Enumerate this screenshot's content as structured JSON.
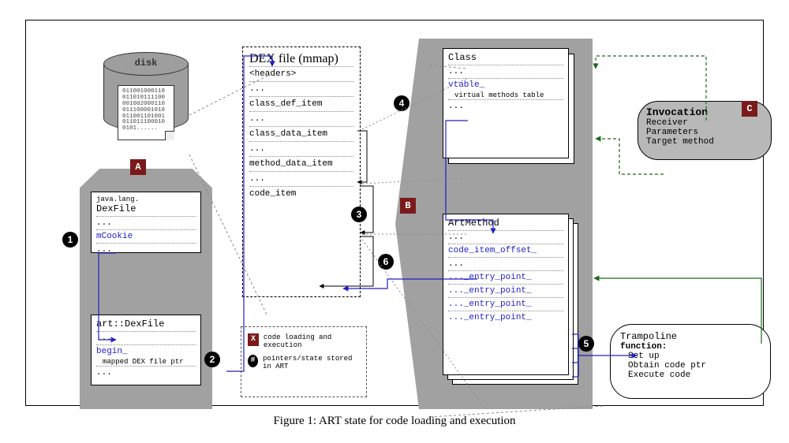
{
  "caption": "Figure 1: ART state for code loading and execution",
  "disk": {
    "label": "disk",
    "bits": [
      "011001000110",
      "011010111100",
      "001002000110",
      "011100001010",
      "011001101001",
      "011011100010",
      "0101......"
    ]
  },
  "badges": {
    "A": "A",
    "B": "B",
    "C": "C",
    "n1": "1",
    "n2": "2",
    "n3": "3",
    "n4": "4",
    "n5": "5",
    "n6": "6"
  },
  "dexfile_java": {
    "pkg": "java.lang.",
    "title": "DexFile",
    "dots": "...",
    "mcookie": "mCookie",
    "dots2": "..."
  },
  "dexfile_art": {
    "title": "art::DexFile",
    "dots": "...",
    "begin": "begin_",
    "note": "mapped DEX file ptr",
    "dots2": "..."
  },
  "dex_mmap": {
    "title": "DEX file (mmap)",
    "r1": "<headers>",
    "r1b": "...",
    "r2": "class_def_item",
    "r2b": "...",
    "r3": "class_data_item",
    "r3b": "...",
    "r4": "method_data_item",
    "r4b": "...",
    "r5": "code_item"
  },
  "class_box": {
    "title": "Class",
    "dots": "...",
    "vtable": "vtable_",
    "vtable_note": "virtual methods table",
    "dots2": "..."
  },
  "artmethod": {
    "title": "ArtMethod",
    "dots": "...",
    "code_item_offset": "code_item_offset_",
    "dots2": "...",
    "ep1": "..._entry_point_",
    "ep2": "..._entry_point_",
    "ep3": "..._entry_point_",
    "ep4": "..._entry_point_"
  },
  "invocation": {
    "title": "Invocation",
    "l1": "Receiver",
    "l2": "Parameters",
    "l3": "Target method"
  },
  "trampoline": {
    "title": "Trampoline",
    "fn": "function:",
    "l1": "Set up",
    "l2": "Obtain code ptr",
    "l3": "Execute code"
  },
  "legend": {
    "sq": "X",
    "sq_text": "code loading and execution",
    "c": "#",
    "c_text": "pointers/state stored in ART"
  }
}
